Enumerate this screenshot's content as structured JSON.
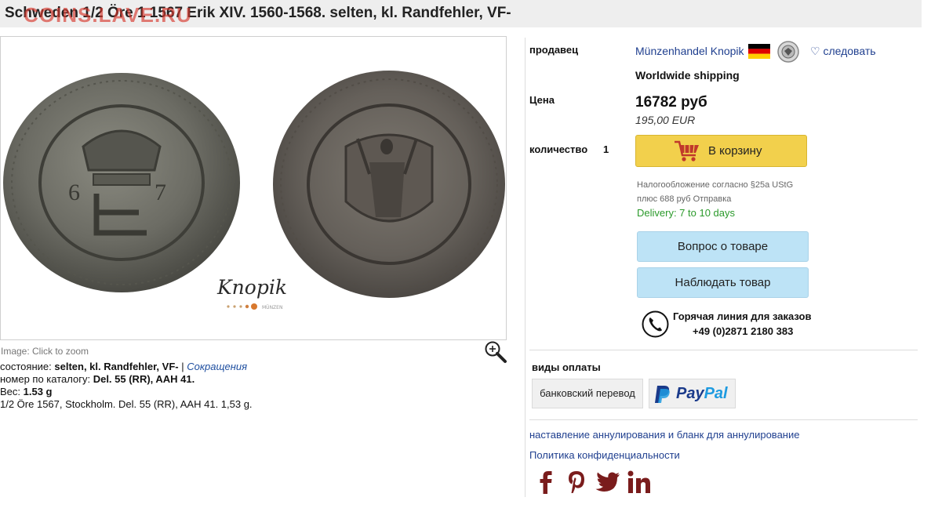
{
  "header": {
    "title": "Schweden 1/2 Öre 1 1567 Erik XIV. 1560-1568. selten, kl. Randfehler, VF-",
    "watermark": "COINS.LAVE.RU"
  },
  "image": {
    "hint": "Image: Click to zoom",
    "icon": "zoom-in-icon",
    "logo_text": "Knopik",
    "logo_sub": "MÜNZEN"
  },
  "details": {
    "condition_label": "состояние:",
    "condition_value": "selten, kl. Randfehler, VF-",
    "condition_separator": "|",
    "abbreviations_link": "Сокращения",
    "catalog_label": "номер по каталогу:",
    "catalog_value": "Del. 55 (RR), AAH 41.",
    "weight_label": "Вес:",
    "weight_value": "1.53 g",
    "description": "1/2 Öre 1567, Stockholm. Del. 55 (RR), AAH 41. 1,53 g."
  },
  "seller": {
    "label": "продавец",
    "name": "Münzenhandel Knopik",
    "flag_icon": "germany-flag-icon",
    "badge_icon": "dealer-seal-icon",
    "follow_label": "следовать",
    "shipping": "Worldwide shipping"
  },
  "price": {
    "label": "Цена",
    "main": "16782 руб",
    "eur": "195,00 EUR"
  },
  "quantity": {
    "label": "количество",
    "value": "1"
  },
  "cart": {
    "button_label": "В корзину",
    "icon": "shopping-cart-icon"
  },
  "tax": {
    "line1": "Налогообложение согласно §25a UStG",
    "line2": "плюс 688 руб Отправка",
    "delivery": "Delivery: 7 to 10 days"
  },
  "actions": {
    "question_label": "Вопрос о товаре",
    "watch_label": "Наблюдать товар"
  },
  "hotline": {
    "icon": "phone-icon",
    "title": "Горячая линия для заказов",
    "phone": "+49 (0)2871 2180 383"
  },
  "payment": {
    "label": "виды оплаты",
    "bank": "банковский перевод",
    "paypal_pay": "Pay",
    "paypal_pal": "Pal"
  },
  "links": {
    "cancellation": "наставление аннулирования и бланк для аннулирование",
    "privacy": "Политика конфиденциальности"
  },
  "social": {
    "color": "#7a1c1c",
    "icons": [
      "facebook-icon",
      "pinterest-icon",
      "twitter-icon",
      "linkedin-icon"
    ]
  },
  "colors": {
    "cart_button": "#f2d04c",
    "action_button": "#bde3f6",
    "delivery_text": "#2b9a2b",
    "link": "#1f3f8f"
  }
}
